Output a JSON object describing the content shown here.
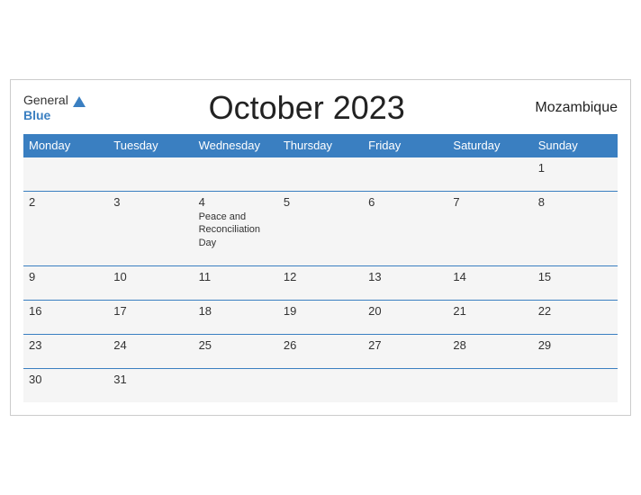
{
  "header": {
    "logo_general": "General",
    "logo_blue": "Blue",
    "title": "October 2023",
    "country": "Mozambique"
  },
  "days_of_week": [
    "Monday",
    "Tuesday",
    "Wednesday",
    "Thursday",
    "Friday",
    "Saturday",
    "Sunday"
  ],
  "weeks": [
    [
      {
        "day": "",
        "event": ""
      },
      {
        "day": "",
        "event": ""
      },
      {
        "day": "",
        "event": ""
      },
      {
        "day": "",
        "event": ""
      },
      {
        "day": "",
        "event": ""
      },
      {
        "day": "",
        "event": ""
      },
      {
        "day": "1",
        "event": ""
      }
    ],
    [
      {
        "day": "2",
        "event": ""
      },
      {
        "day": "3",
        "event": ""
      },
      {
        "day": "4",
        "event": "Peace and Reconciliation Day"
      },
      {
        "day": "5",
        "event": ""
      },
      {
        "day": "6",
        "event": ""
      },
      {
        "day": "7",
        "event": ""
      },
      {
        "day": "8",
        "event": ""
      }
    ],
    [
      {
        "day": "9",
        "event": ""
      },
      {
        "day": "10",
        "event": ""
      },
      {
        "day": "11",
        "event": ""
      },
      {
        "day": "12",
        "event": ""
      },
      {
        "day": "13",
        "event": ""
      },
      {
        "day": "14",
        "event": ""
      },
      {
        "day": "15",
        "event": ""
      }
    ],
    [
      {
        "day": "16",
        "event": ""
      },
      {
        "day": "17",
        "event": ""
      },
      {
        "day": "18",
        "event": ""
      },
      {
        "day": "19",
        "event": ""
      },
      {
        "day": "20",
        "event": ""
      },
      {
        "day": "21",
        "event": ""
      },
      {
        "day": "22",
        "event": ""
      }
    ],
    [
      {
        "day": "23",
        "event": ""
      },
      {
        "day": "24",
        "event": ""
      },
      {
        "day": "25",
        "event": ""
      },
      {
        "day": "26",
        "event": ""
      },
      {
        "day": "27",
        "event": ""
      },
      {
        "day": "28",
        "event": ""
      },
      {
        "day": "29",
        "event": ""
      }
    ],
    [
      {
        "day": "30",
        "event": ""
      },
      {
        "day": "31",
        "event": ""
      },
      {
        "day": "",
        "event": ""
      },
      {
        "day": "",
        "event": ""
      },
      {
        "day": "",
        "event": ""
      },
      {
        "day": "",
        "event": ""
      },
      {
        "day": "",
        "event": ""
      }
    ]
  ]
}
